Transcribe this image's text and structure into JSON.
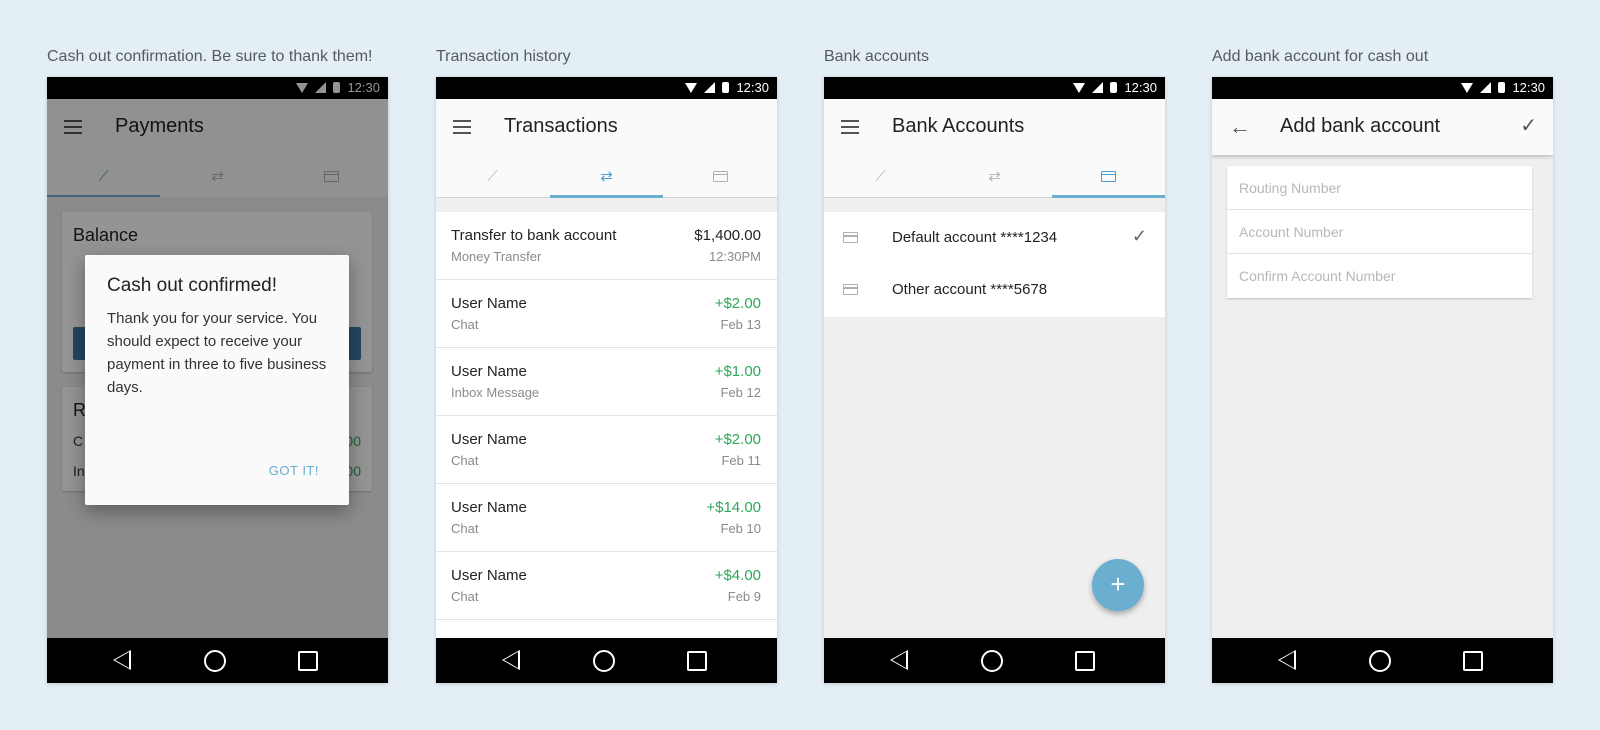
{
  "captions": [
    "Cash out confirmation. Be sure to thank them!",
    "Transaction history",
    "Bank accounts",
    "Add bank account for cash out"
  ],
  "status_time": "12:30",
  "colors": {
    "accent": "#6aaed0",
    "positive": "#2fa85a",
    "background": "#e3eef5"
  },
  "icons": {
    "menu": "hamburger-menu-icon",
    "tab_trend": "trend-icon",
    "tab_transfer": "transfer-arrows-icon",
    "tab_card": "credit-card-icon",
    "check": "check-icon",
    "back": "back-arrow-icon",
    "add": "plus-icon"
  },
  "screen1": {
    "title": "Payments",
    "active_tab": 0,
    "balance_title": "Balance",
    "section2_initial": "R",
    "section2_rows": [
      "C",
      "In"
    ],
    "section2_amounts": [
      "00",
      "00"
    ],
    "dialog": {
      "title": "Cash out confirmed!",
      "body": "Thank you for your service. You should expect to receive your payment in three to five business days.",
      "button": "GOT IT!"
    }
  },
  "screen2": {
    "title": "Transactions",
    "active_tab": 1,
    "rows": [
      {
        "name": "Transfer to bank account",
        "sub": "Money Transfer",
        "amount": "$1,400.00",
        "date": "12:30PM"
      },
      {
        "name": "User Name",
        "sub": "Chat",
        "amount": "+$2.00",
        "date": "Feb 13"
      },
      {
        "name": "User Name",
        "sub": "Inbox Message",
        "amount": "+$1.00",
        "date": "Feb 12"
      },
      {
        "name": "User Name",
        "sub": "Chat",
        "amount": "+$2.00",
        "date": "Feb 11"
      },
      {
        "name": "User Name",
        "sub": "Chat",
        "amount": "+$14.00",
        "date": "Feb 10"
      },
      {
        "name": "User Name",
        "sub": "Chat",
        "amount": "+$4.00",
        "date": "Feb 9"
      }
    ]
  },
  "screen3": {
    "title": "Bank Accounts",
    "active_tab": 2,
    "accounts": [
      {
        "name": "Default account ****1234",
        "selected": true
      },
      {
        "name": "Other account ****5678",
        "selected": false
      }
    ],
    "fab_label": "+"
  },
  "screen4": {
    "title": "Add bank account",
    "fields": {
      "routing_placeholder": "Routing Number",
      "account_placeholder": "Account Number",
      "confirm_placeholder": "Confirm Account Number"
    }
  }
}
